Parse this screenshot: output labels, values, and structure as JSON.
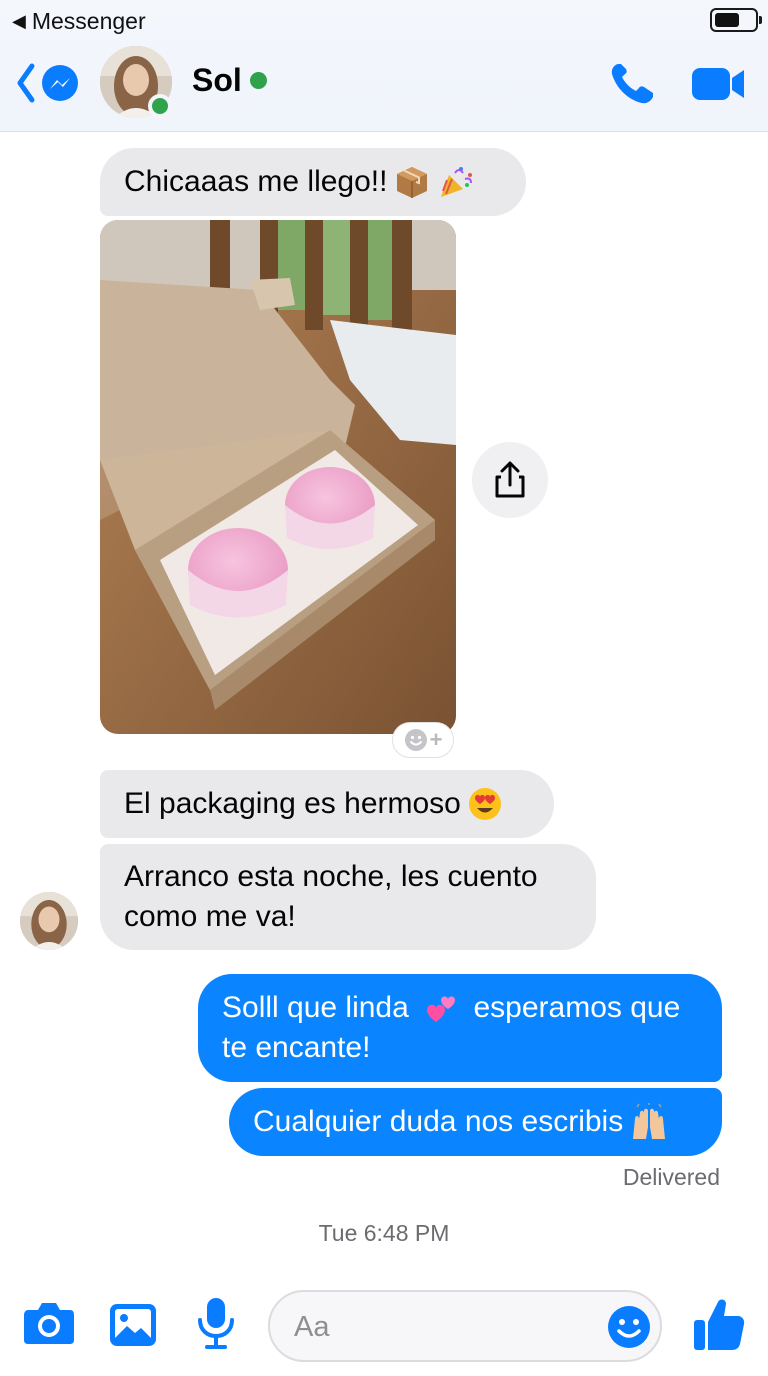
{
  "status_bar": {
    "back_app_label": "Messenger"
  },
  "header": {
    "contact_name": "Sol",
    "contact_online": true
  },
  "messages": [
    {
      "direction": "incoming",
      "text": "Chicaaas me llego!!",
      "emoji": [
        "package-emoji",
        "party-popper-emoji"
      ]
    },
    {
      "direction": "incoming",
      "type": "photo",
      "description_icon": "photo-attachment"
    },
    {
      "direction": "incoming",
      "text": "El packaging es hermoso",
      "emoji": [
        "heart-eyes-emoji"
      ]
    },
    {
      "direction": "incoming",
      "text": "Arranco esta noche, les cuento como me va!"
    },
    {
      "direction": "outgoing",
      "text_before_emoji": "Solll que linda",
      "emoji": [
        "two-hearts-emoji"
      ],
      "text_after_emoji": "esperamos que te encante!"
    },
    {
      "direction": "outgoing",
      "text": "Cualquier duda nos escribis",
      "emoji": [
        "raising-hands-emoji"
      ]
    }
  ],
  "delivery_status": "Delivered",
  "timestamp": "Tue 6:48 PM",
  "composer": {
    "placeholder": "Aa"
  },
  "colors": {
    "accent": "#0a84ff",
    "incoming_bubble": "#e9e9eb",
    "online": "#31a24c"
  }
}
